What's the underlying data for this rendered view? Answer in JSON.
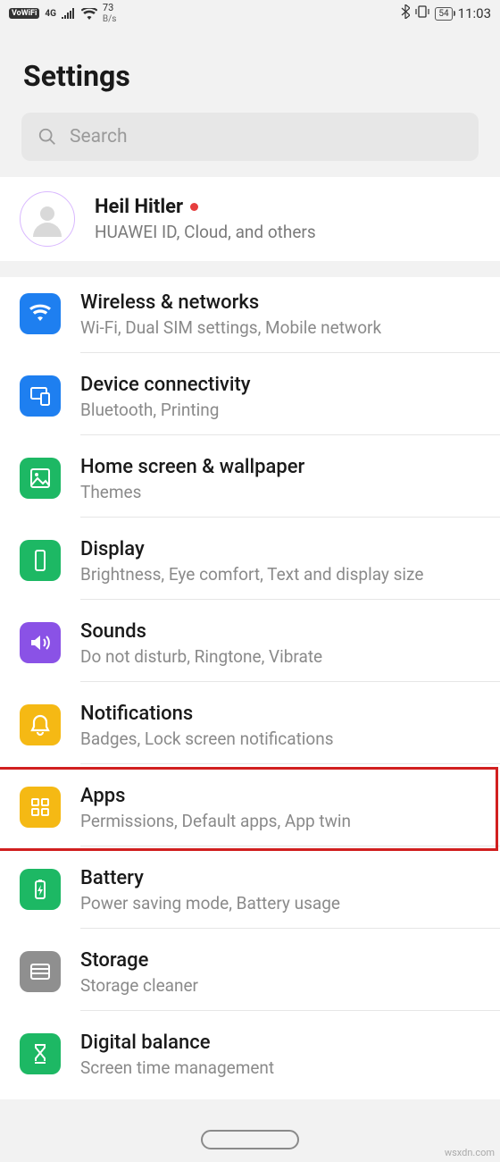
{
  "status": {
    "vowifi": "VoWiFi",
    "net_type": "4G",
    "speed_value": "73",
    "speed_unit": "B/s",
    "battery": "54",
    "time": "11:03"
  },
  "page_title": "Settings",
  "search": {
    "placeholder": "Search"
  },
  "account": {
    "name": "Heil Hitler",
    "subtitle": "HUAWEI ID, Cloud, and others"
  },
  "items": [
    {
      "icon": "wifi",
      "color": "ic-blue",
      "title": "Wireless & networks",
      "sub": "Wi-Fi, Dual SIM settings, Mobile network"
    },
    {
      "icon": "devices",
      "color": "ic-blue2",
      "title": "Device connectivity",
      "sub": "Bluetooth, Printing"
    },
    {
      "icon": "image",
      "color": "ic-green",
      "title": "Home screen & wallpaper",
      "sub": "Themes"
    },
    {
      "icon": "display",
      "color": "ic-green",
      "title": "Display",
      "sub": "Brightness, Eye comfort, Text and display size"
    },
    {
      "icon": "sound",
      "color": "ic-purple",
      "title": "Sounds",
      "sub": "Do not disturb, Ringtone, Vibrate"
    },
    {
      "icon": "bell",
      "color": "ic-yellow",
      "title": "Notifications",
      "sub": "Badges, Lock screen notifications"
    },
    {
      "icon": "apps",
      "color": "ic-yellow",
      "title": "Apps",
      "sub": "Permissions, Default apps, App twin"
    },
    {
      "icon": "battery",
      "color": "ic-green",
      "title": "Battery",
      "sub": "Power saving mode, Battery usage"
    },
    {
      "icon": "storage",
      "color": "ic-gray",
      "title": "Storage",
      "sub": "Storage cleaner"
    },
    {
      "icon": "hourglass",
      "color": "ic-green",
      "title": "Digital balance",
      "sub": "Screen time management"
    }
  ],
  "highlight_index": 6,
  "watermark": "wsxdn.com"
}
